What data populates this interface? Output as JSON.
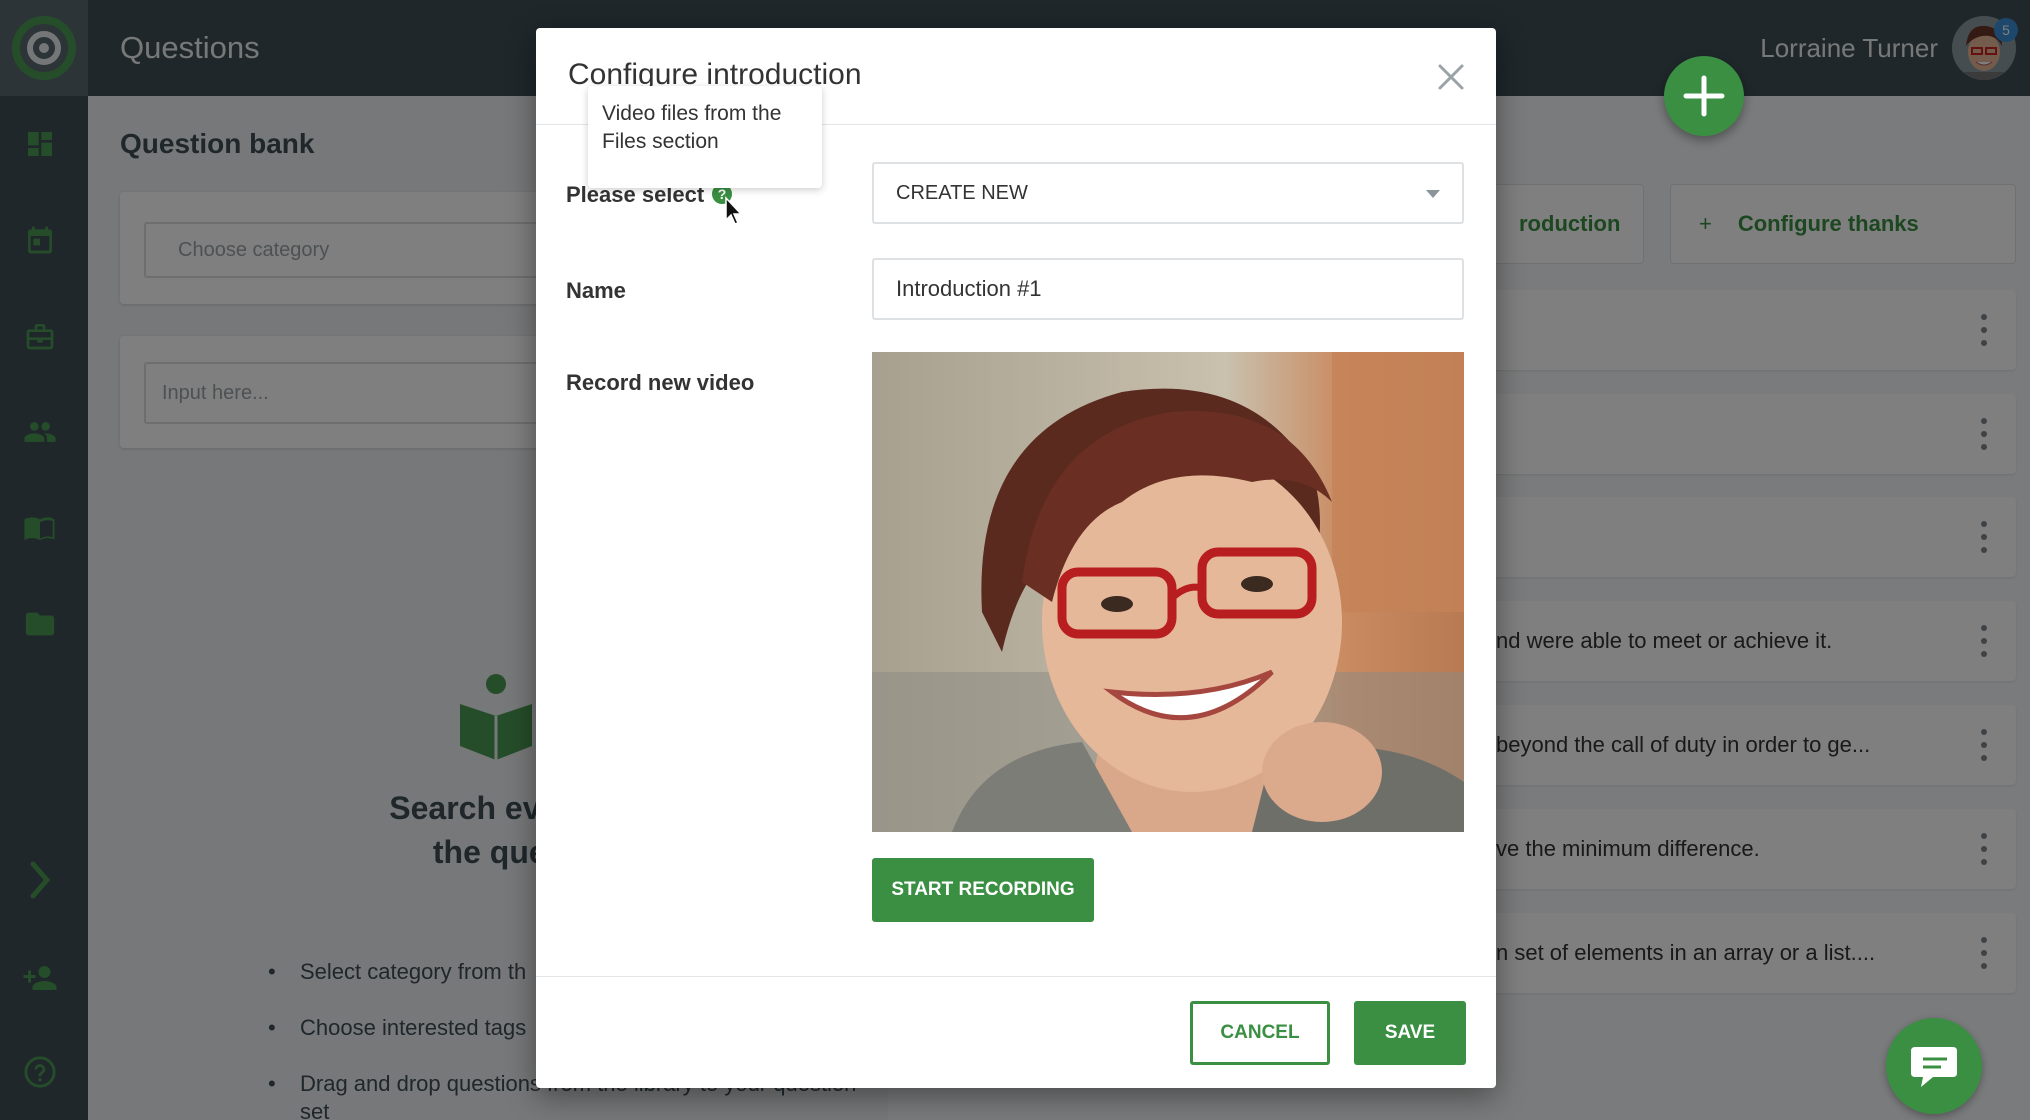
{
  "header": {
    "page_title": "Questions",
    "user_name": "Lorraine Turner",
    "notification_count": "5"
  },
  "sidebar": {
    "items": [
      {
        "icon": "dashboard-icon"
      },
      {
        "icon": "calendar-icon"
      },
      {
        "icon": "briefcase-icon"
      },
      {
        "icon": "people-icon"
      },
      {
        "icon": "book-icon"
      },
      {
        "icon": "folder-icon"
      },
      {
        "icon": "chevron-right-icon"
      },
      {
        "icon": "add-user-icon"
      },
      {
        "icon": "help-icon"
      }
    ]
  },
  "question_bank": {
    "title": "Question bank",
    "category_placeholder": "Choose category",
    "search_placeholder": "Input here...",
    "empty_heading": "Search everything\nthe question",
    "tips": [
      "Select category from th",
      "Choose interested tags",
      "Drag and drop questions from the library to your question set"
    ]
  },
  "question_set": {
    "configure_intro_label": "roduction",
    "configure_thanks_label": "Configure thanks",
    "questions": [
      "",
      "",
      "",
      "nd were able to meet or achieve it.",
      "beyond the call of duty in order to ge...",
      "ve the minimum difference.",
      "n set of elements in an array or a list...."
    ]
  },
  "modal": {
    "title": "Configure introduction",
    "tooltip": "Video files from the Files section",
    "select_label": "Please select",
    "select_value": "CREATE NEW",
    "name_label": "Name",
    "name_value": "Introduction #1",
    "record_label": "Record new video",
    "start_recording_label": "START RECORDING",
    "cancel_label": "CANCEL",
    "save_label": "SAVE"
  },
  "colors": {
    "sidebar_bg": "#3f4e57",
    "accent_green": "#3a8f43",
    "badge_blue": "#3b8ed6"
  }
}
